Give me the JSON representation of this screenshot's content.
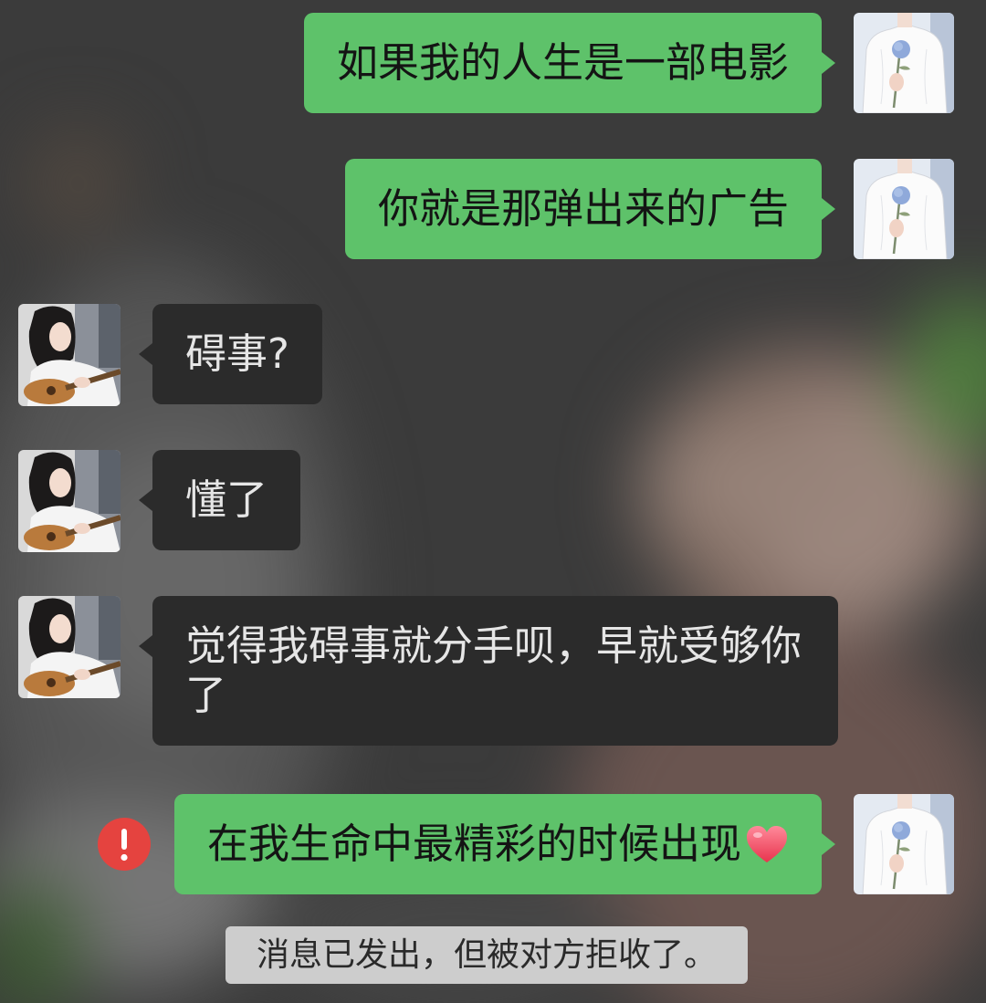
{
  "chat": {
    "messages": [
      {
        "outgoing": true,
        "text": "如果我的人生是一部电影",
        "avatar": "avatar-boy-with-blue-rose"
      },
      {
        "outgoing": true,
        "text": "你就是那弹出来的广告",
        "avatar": "avatar-boy-with-blue-rose"
      },
      {
        "outgoing": false,
        "text": "碍事?",
        "avatar": "avatar-girl-with-guitar"
      },
      {
        "outgoing": false,
        "text": "懂了",
        "avatar": "avatar-girl-with-guitar"
      },
      {
        "outgoing": false,
        "text": "觉得我碍事就分手呗，早就受够你了",
        "avatar": "avatar-girl-with-guitar"
      },
      {
        "outgoing": true,
        "text": "在我生命中最精彩的时候出现",
        "emoji": "red-heart-icon",
        "failed": true,
        "status_icon": "error-icon",
        "avatar": "avatar-boy-with-blue-rose"
      }
    ],
    "system_notice": "消息已发出，但被对方拒收了。"
  },
  "colors": {
    "sent_bubble": "#5ec26a",
    "received_bubble": "#2b2b2b",
    "sent_text": "#141414",
    "received_text": "#e6e6e6",
    "error": "#e5433f",
    "notice_bg": "#cdcdcd"
  }
}
